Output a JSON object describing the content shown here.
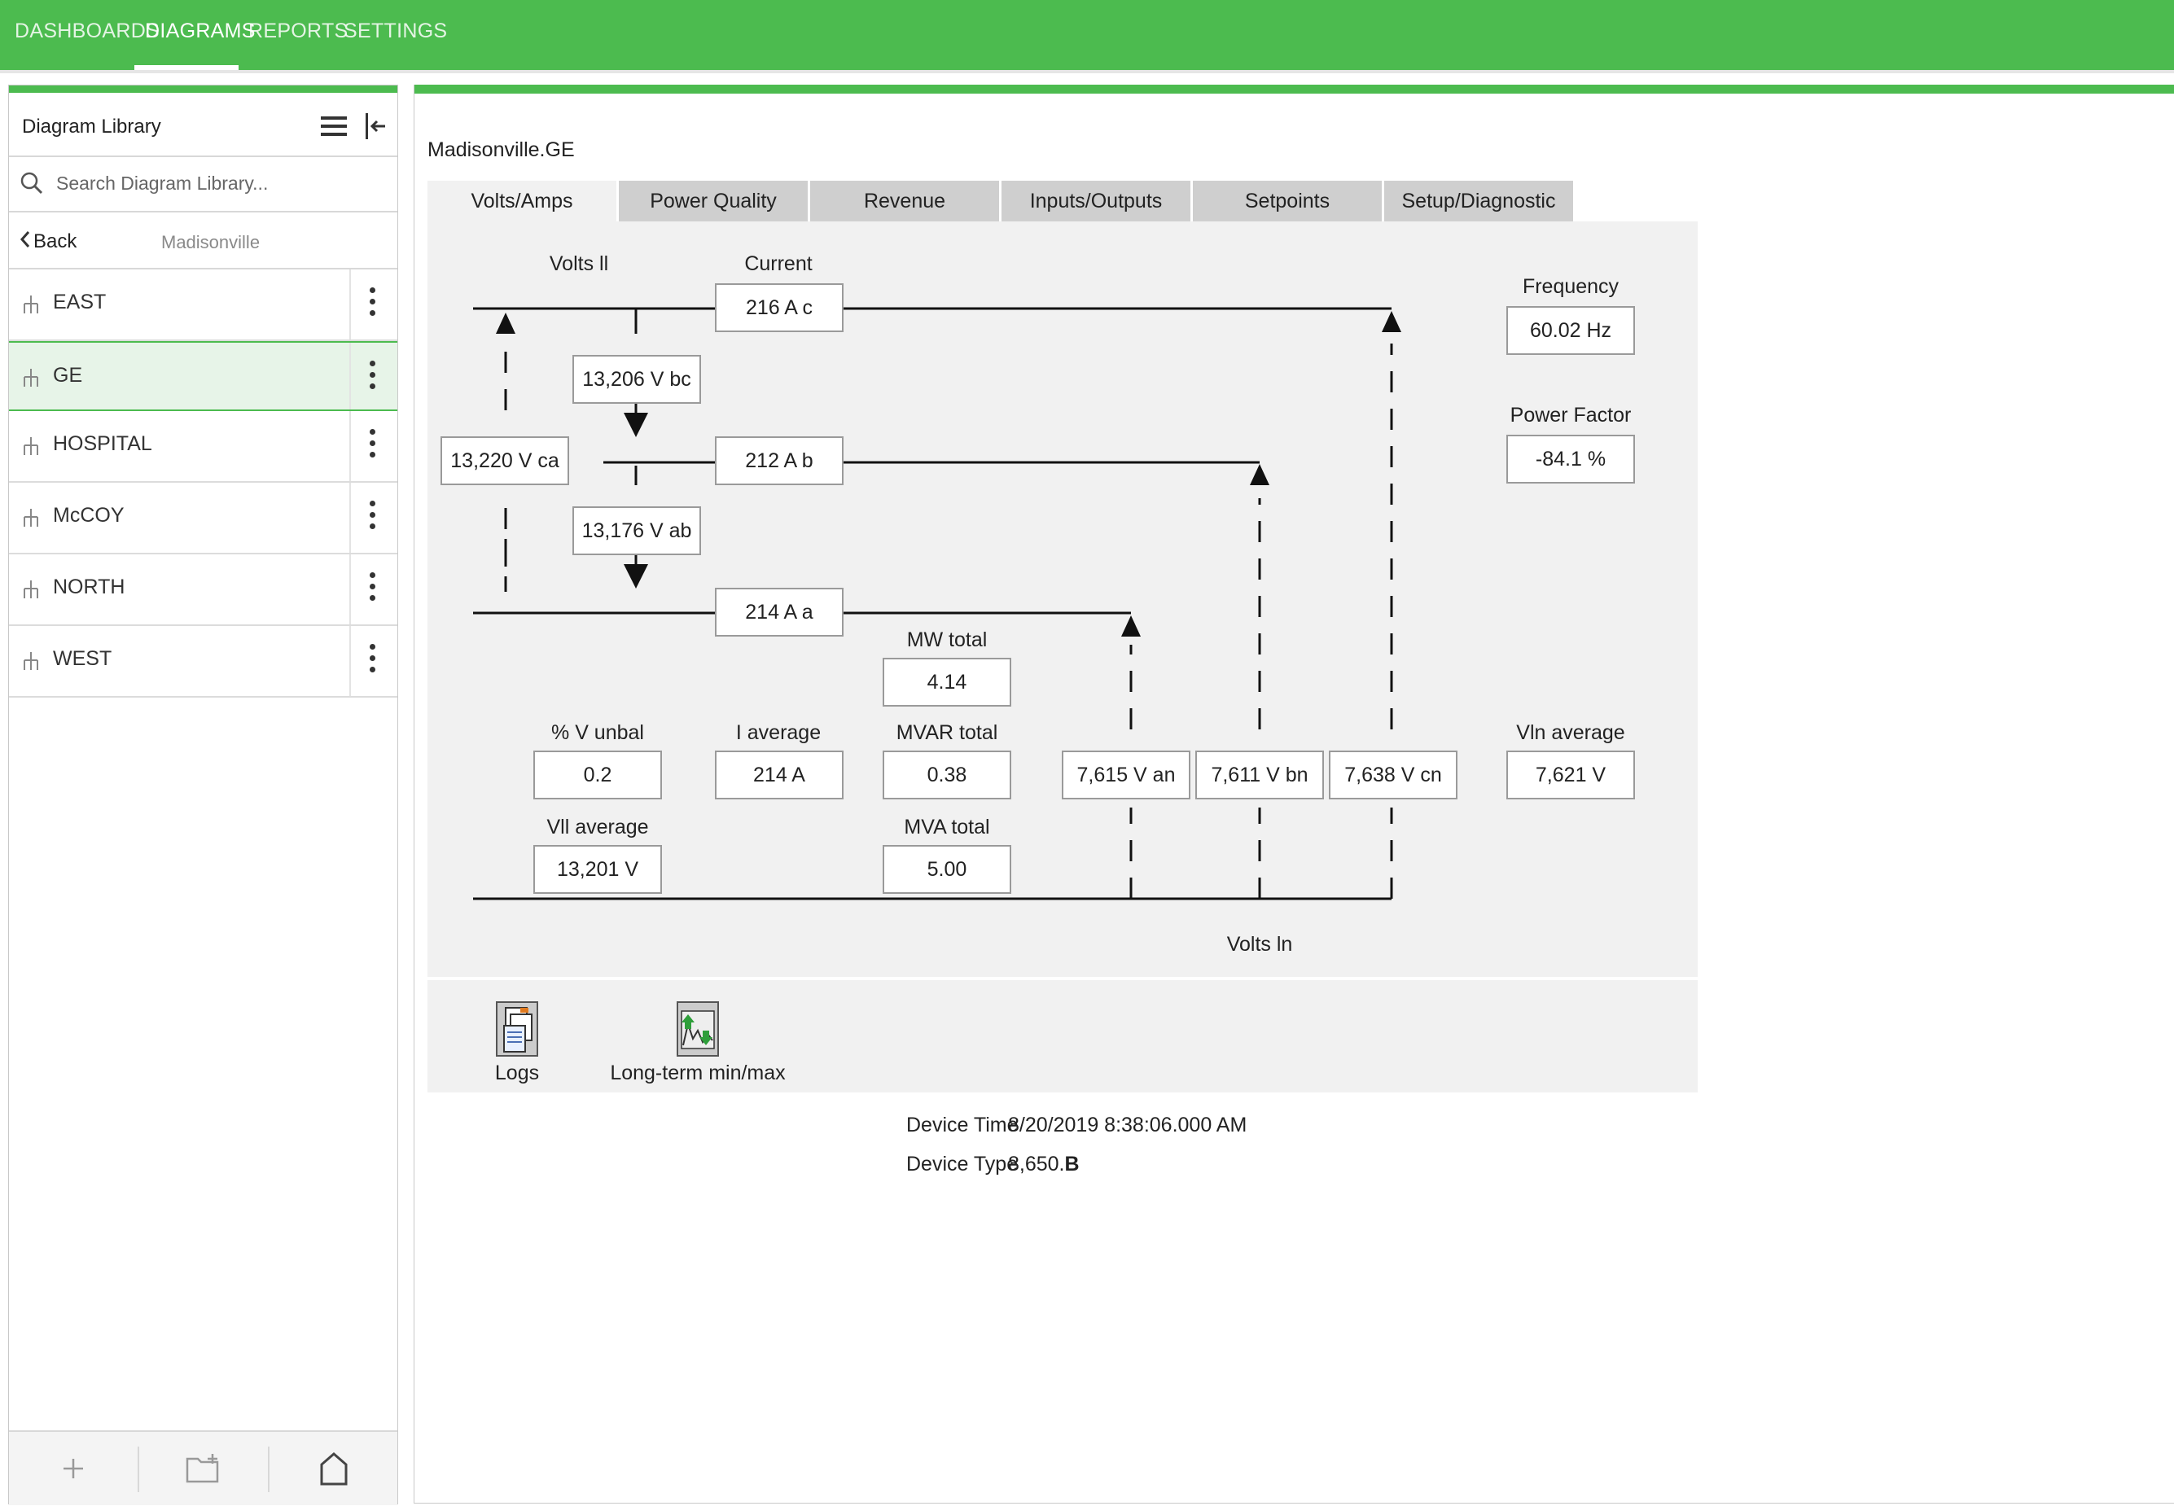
{
  "nav": {
    "items": [
      {
        "label": "DASHBOARDS"
      },
      {
        "label": "DIAGRAMS"
      },
      {
        "label": "REPORTS"
      },
      {
        "label": "SETTINGS"
      }
    ],
    "active_index": 1
  },
  "sidebar": {
    "title": "Diagram Library",
    "search_placeholder": "Search Diagram Library...",
    "back_label": "Back",
    "breadcrumb": "Madisonville",
    "items": [
      {
        "label": "EAST"
      },
      {
        "label": "GE"
      },
      {
        "label": "HOSPITAL"
      },
      {
        "label": "McCOY"
      },
      {
        "label": "NORTH"
      },
      {
        "label": "WEST"
      }
    ],
    "selected_index": 1
  },
  "main": {
    "device_title": "Madisonville.GE",
    "tabs": [
      {
        "label": "Volts/Amps"
      },
      {
        "label": "Power Quality"
      },
      {
        "label": "Revenue"
      },
      {
        "label": "Inputs/Outputs"
      },
      {
        "label": "Setpoints"
      },
      {
        "label": "Setup/Diagnostic"
      }
    ],
    "active_tab_index": 0,
    "diagram": {
      "labels": {
        "volts_ll": "Volts ll",
        "current": "Current",
        "frequency": "Frequency",
        "power_factor": "Power Factor",
        "mw_total": "MW total",
        "v_unbal": "% V unbal",
        "i_average": "I average",
        "mvar_total": "MVAR total",
        "vln_average": "Vln average",
        "vll_average": "Vll average",
        "mva_total": "MVA total",
        "volts_ln": "Volts ln"
      },
      "values": {
        "current_c": "216 A c",
        "current_b": "212 A b",
        "current_a": "214 A a",
        "v_bc": "13,206 V bc",
        "v_ca": "13,220 V ca",
        "v_ab": "13,176 V ab",
        "frequency": "60.02 Hz",
        "power_factor": "-84.1 %",
        "mw_total": "4.14",
        "v_unbal": "0.2",
        "i_average": "214 A",
        "mvar_total": "0.38",
        "v_an": "7,615 V an",
        "v_bn": "7,611 V bn",
        "v_cn": "7,638 V cn",
        "vln_average": "7,621 V",
        "vll_average": "13,201 V",
        "mva_total": "5.00"
      }
    },
    "tools": [
      {
        "label": "Logs",
        "icon": "logs-icon"
      },
      {
        "label": "Long-term min/max",
        "icon": "min-max-chart-icon"
      }
    ],
    "device_info": {
      "time_label": "Device Time",
      "time_value": "8/20/2019 8:38:06.000 AM",
      "type_label": "Device Type",
      "type_value": "8,650.",
      "type_suffix": "B"
    }
  },
  "colors": {
    "brand_green": "#4cbb4f",
    "selected_bg": "#e7f4e8",
    "panel_gray": "#f1f1f1",
    "tab_gray": "#cfcfcf"
  }
}
